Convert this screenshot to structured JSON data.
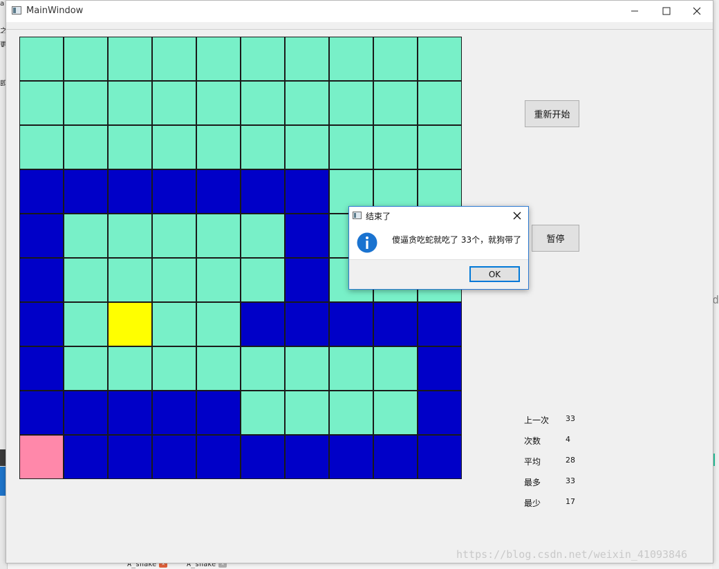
{
  "window": {
    "title": "MainWindow",
    "controls": [
      "minimize-icon",
      "maximize-icon",
      "close-icon"
    ]
  },
  "board": {
    "rows": 10,
    "cols": 10,
    "legend": {
      "E": "empty",
      "S": "snake-body",
      "F": "food",
      "H": "snake-head"
    },
    "colors": {
      "E": "#78f0c8",
      "S": "#0000c8",
      "F": "#ffff00",
      "H": "#ff88aa"
    },
    "grid": [
      "EEEEEEEEEE",
      "EEEEEEEEEE",
      "EEEEEEEEEE",
      "SSSSSSSEEE",
      "SEEEEESEEE",
      "SEEEEESEEE",
      "SEFEESSSSS",
      "SEEEEEEEES",
      "SSSSSEEEES",
      "HSSSSSSSSS"
    ]
  },
  "controls": {
    "restart_label": "重新开始",
    "pause_label": "暂停"
  },
  "stats": [
    {
      "label": "上一次",
      "value": "33"
    },
    {
      "label": "次数",
      "value": "4"
    },
    {
      "label": "平均",
      "value": "28"
    },
    {
      "label": "最多",
      "value": "33"
    },
    {
      "label": "最少",
      "value": "17"
    }
  ],
  "dialog": {
    "title": "结束了",
    "message": "傻逼贪吃蛇就吃了 33个，就狗带了",
    "ok_label": "OK",
    "icon": "info-icon"
  },
  "watermark": "https://blog.csdn.net/weixin_41093846",
  "background": {
    "bottom_tabs": [
      "A_snake",
      "A_snake"
    ]
  }
}
